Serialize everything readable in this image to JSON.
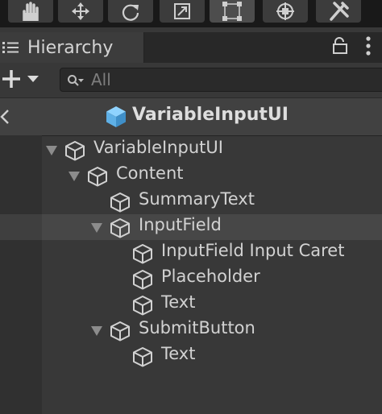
{
  "toolbar": {
    "tools": [
      {
        "name": "hand-tool",
        "active": false
      },
      {
        "name": "move-tool",
        "active": false
      },
      {
        "name": "rotate-tool",
        "active": false
      },
      {
        "name": "scale-tool",
        "active": false
      },
      {
        "name": "rect-tool",
        "active": true
      },
      {
        "name": "transform-tool",
        "active": false
      },
      {
        "name": "custom-tool",
        "active": false
      }
    ]
  },
  "panel": {
    "tab_label": "Hierarchy",
    "search_placeholder": "All"
  },
  "scene": {
    "title": "VariableInputUI"
  },
  "tree": [
    {
      "label": "VariableInputUI",
      "depth": 0,
      "expanded": true,
      "has_children": true,
      "selected": false
    },
    {
      "label": "Content",
      "depth": 1,
      "expanded": true,
      "has_children": true,
      "selected": false
    },
    {
      "label": "SummaryText",
      "depth": 2,
      "expanded": false,
      "has_children": false,
      "selected": false
    },
    {
      "label": "InputField",
      "depth": 2,
      "expanded": true,
      "has_children": true,
      "selected": true
    },
    {
      "label": "InputField Input Caret",
      "depth": 3,
      "expanded": false,
      "has_children": false,
      "selected": false
    },
    {
      "label": "Placeholder",
      "depth": 3,
      "expanded": false,
      "has_children": false,
      "selected": false
    },
    {
      "label": "Text",
      "depth": 3,
      "expanded": false,
      "has_children": false,
      "selected": false
    },
    {
      "label": "SubmitButton",
      "depth": 2,
      "expanded": true,
      "has_children": true,
      "selected": false
    },
    {
      "label": "Text",
      "depth": 3,
      "expanded": false,
      "has_children": false,
      "selected": false
    }
  ],
  "colors": {
    "background": "#383838",
    "selected_row": "#474747",
    "scene_icon": "#5fb0e6",
    "text": "#d2d2d2"
  }
}
